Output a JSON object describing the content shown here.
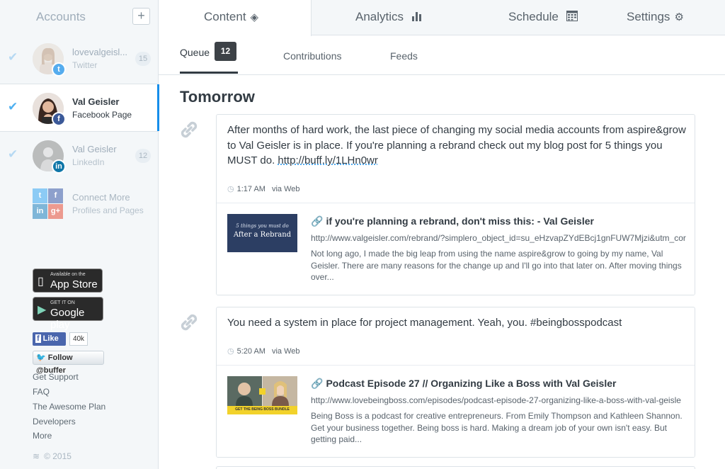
{
  "sidebar": {
    "title": "Accounts",
    "add_label": "+",
    "accounts": [
      {
        "name": "lovevalgeisl...",
        "type": "Twitter",
        "count": "15",
        "network_badge": "t"
      },
      {
        "name": "Val Geisler",
        "type": "Facebook Page",
        "network_badge": "f"
      },
      {
        "name": "Val Geisler",
        "type": "LinkedIn",
        "count": "12",
        "network_badge": "in"
      }
    ],
    "connect_more": {
      "title": "Connect More",
      "subtitle": "Profiles and Pages"
    },
    "app_store": {
      "small": "Available on the",
      "big": "App Store"
    },
    "google_play": {
      "small": "GET IT ON",
      "big": "Google play"
    },
    "fb_like": {
      "label": "Like",
      "count": "40k"
    },
    "tw_follow": {
      "label": "Follow @buffer"
    },
    "links": [
      "Get Support",
      "FAQ",
      "The Awesome Plan",
      "Developers",
      "More"
    ],
    "copyright": "© 2015"
  },
  "tabs": [
    {
      "label": "Content",
      "icon": "layers-icon"
    },
    {
      "label": "Analytics",
      "icon": "bar-chart-icon"
    },
    {
      "label": "Schedule",
      "icon": "calendar-icon"
    },
    {
      "label": "Settings",
      "icon": "gear-icon"
    }
  ],
  "subtabs": {
    "queue": "Queue",
    "queue_count": "12",
    "contributions": "Contributions",
    "feeds": "Feeds"
  },
  "day_heading": "Tomorrow",
  "posts": [
    {
      "text": "After months of hard work, the last piece of changing my social media accounts from aspire&grow to Val Geisler is in place. If you're planning a rebrand check out my blog post for 5 things you MUST do.",
      "url": "http://buff.ly/1LHn0wr",
      "time": "1:17 AM",
      "via": "via Web",
      "attachment": {
        "thumb_line1": "5 things you must do",
        "thumb_line2": "After a Rebrand",
        "title": "if you're planning a rebrand, don't miss this: - Val Geisler",
        "url": "http://www.valgeisler.com/rebrand/?simplero_object_id=su_eHzvapZYdEBcj1gnFUW7Mjzi&utm_cor",
        "description": "Not long ago, I made the big leap from using the name aspire&grow to going by my name, Val Geisler. There are many reasons for the change up and I'll go into that later on. After moving things over..."
      }
    },
    {
      "text": "You need a system in place for project management. Yeah, you. #beingbosspodcast",
      "time": "5:20 AM",
      "via": "via Web",
      "attachment": {
        "thumb_caption": "GET THE BEING BOSS BUNDLE",
        "title": "Podcast Episode 27 // Organizing Like a Boss with Val Geisler",
        "url": "http://www.lovebeingboss.com/episodes/podcast-episode-27-organizing-like-a-boss-with-val-geisle",
        "description": "Being Boss is a podcast for creative entrepreneurs. From Emily Thompson and Kathleen Shannon. Get your business together. Being boss is hard. Making a dream job of your own isn't easy. But getting paid..."
      }
    }
  ],
  "colors": {
    "accent": "#168eea",
    "check": "#4fb0f0",
    "twitter": "#55acee",
    "facebook": "#3b5998",
    "linkedin": "#0e76a8",
    "google": "#dd4b39"
  }
}
